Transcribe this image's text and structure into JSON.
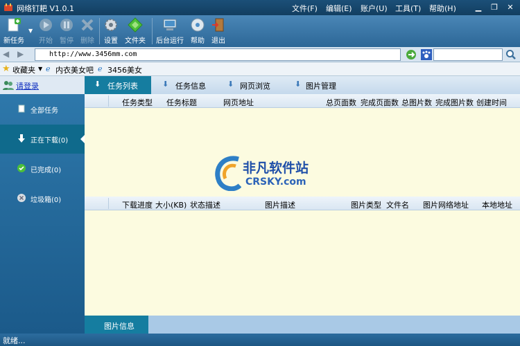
{
  "window": {
    "title": "网络钉耙 V1.0.1"
  },
  "menu": [
    "文件(F)",
    "编辑(E)",
    "账户(U)",
    "工具(T)",
    "帮助(H)"
  ],
  "toolbar": {
    "new_task": "新任务",
    "start": "开始",
    "pause": "暂停",
    "delete": "删除",
    "settings": "设置",
    "folder": "文件夹",
    "background": "后台运行",
    "help": "帮助",
    "exit": "退出"
  },
  "address": {
    "url": "http://www.3456mm.com",
    "search": ""
  },
  "favorites": {
    "label": "收藏夹",
    "items": [
      "内衣美女吧",
      "3456美女"
    ]
  },
  "sidebar": {
    "login": "请登录",
    "items": [
      {
        "label": "全部任务",
        "icon": "document-icon"
      },
      {
        "label": "正在下载(0)",
        "icon": "download-arrow-icon"
      },
      {
        "label": "已完成(0)",
        "icon": "checkmark-icon"
      },
      {
        "label": "垃圾箱(0)",
        "icon": "trash-icon"
      }
    ]
  },
  "tabs": [
    "任务列表",
    "任务信息",
    "网页浏览",
    "图片管理"
  ],
  "task_columns": [
    "任务类型",
    "任务标题",
    "网页地址",
    "总页面数",
    "完成页面数",
    "总图片数",
    "完成图片数",
    "创建时间"
  ],
  "image_columns": [
    "下载进度",
    "大小(KB)",
    "状态描述",
    "图片描述",
    "图片类型",
    "文件名",
    "图片网络地址",
    "本地地址"
  ],
  "watermark": {
    "cn": "非凡软件站",
    "en": "CRSKY.com"
  },
  "bottom_tab": "图片信息",
  "status": "就绪...",
  "colors": {
    "accent": "#157da0",
    "panel": "#1b5a8a",
    "grid_bg": "#fcfbe0"
  }
}
